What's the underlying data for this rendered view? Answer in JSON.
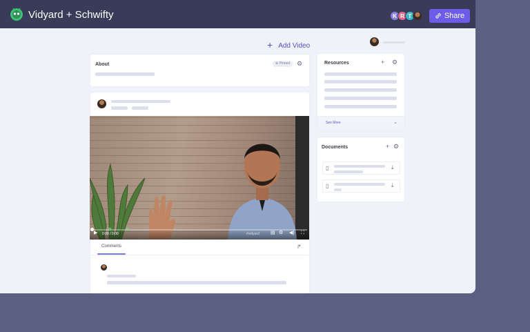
{
  "app": {
    "title": "Vidyard + Schwifty"
  },
  "header": {
    "collaborators": [
      {
        "initial": "K",
        "color": "#8a7fe0"
      },
      {
        "initial": "R",
        "color": "#e06a8a"
      },
      {
        "initial": "T",
        "color": "#3fb7c4"
      },
      {
        "initial": "",
        "color": "#6b4a3a"
      }
    ],
    "share_label": "Share"
  },
  "main": {
    "add_video_label": "Add Video",
    "about": {
      "title": "About",
      "pinned_label": "Pinned"
    },
    "video": {
      "time": "0:00 / 0:00",
      "watermark": "#vidyard"
    },
    "comments": {
      "tab_label": "Comments"
    }
  },
  "sidebar": {
    "resources": {
      "title": "Resources",
      "see_more_label": "See More"
    },
    "documents": {
      "title": "Documents"
    }
  },
  "icons": {
    "logo": "vidyard-logo-icon",
    "add": "plus-icon",
    "settings": "gear-icon",
    "share": "link-icon",
    "download": "download-icon",
    "document": "file-icon",
    "chevron": "chevron-down-icon",
    "forward": "share-arrow-icon"
  },
  "colors": {
    "topbar": "#393c58",
    "accent": "#6c5ce7",
    "link": "#5350c9",
    "background": "#f0f2fa"
  }
}
